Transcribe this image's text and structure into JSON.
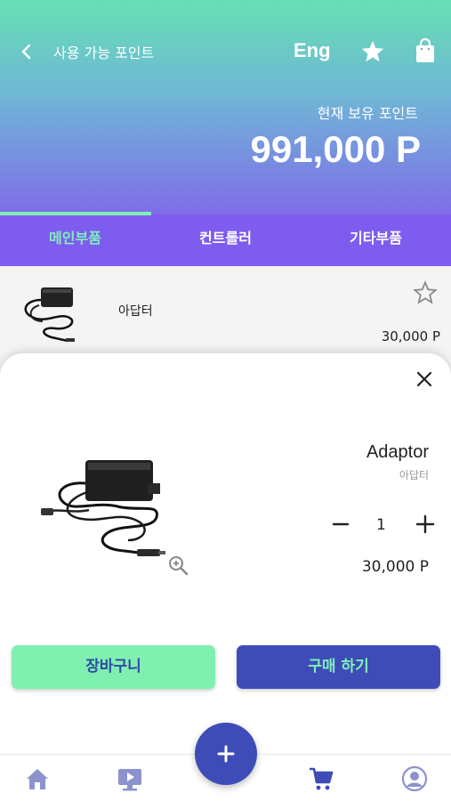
{
  "header": {
    "title": "사용 가능 포인트",
    "lang_label": "Eng",
    "points_label": "현재 보유 포인트",
    "points_value": "991,000 P"
  },
  "tabs": [
    {
      "label": "메인부품",
      "active": true
    },
    {
      "label": "컨트롤러",
      "active": false
    },
    {
      "label": "기타부품",
      "active": false
    }
  ],
  "list": {
    "items": [
      {
        "name": "아답터",
        "price": "30,000 P"
      }
    ]
  },
  "sheet": {
    "title": "Adaptor",
    "subtitle": "아답터",
    "quantity": "1",
    "price": "30,000 P",
    "cart_label": "장바구니",
    "buy_label": "구매 하기"
  },
  "colors": {
    "accent_green": "#7ff0b0",
    "accent_blue": "#3e4cb8",
    "tab_bg": "#7f5cf0"
  },
  "icons": {
    "back": "chevron-left-icon",
    "favorite": "star-icon",
    "bag": "shopping-bag-icon",
    "close": "close-icon",
    "zoom": "zoom-in-icon",
    "nav": [
      "home-icon",
      "video-icon",
      "plus-icon",
      "cart-icon",
      "user-icon"
    ]
  }
}
